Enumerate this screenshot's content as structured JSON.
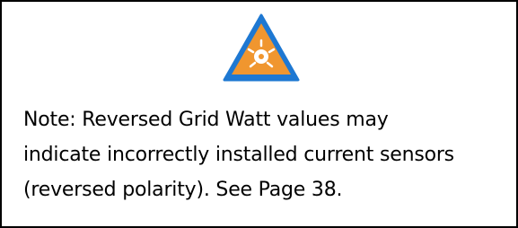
{
  "note": {
    "icon": "warning-triangle-icon",
    "lines": [
      "Note: Reversed Grid Watt values may",
      "indicate incorrectly installed current sensors",
      "(reversed polarity). See Page 38."
    ]
  },
  "colors": {
    "triangle_fill": "#F0962F",
    "triangle_border": "#1E78D2",
    "border": "#000000",
    "text": "#000000"
  }
}
